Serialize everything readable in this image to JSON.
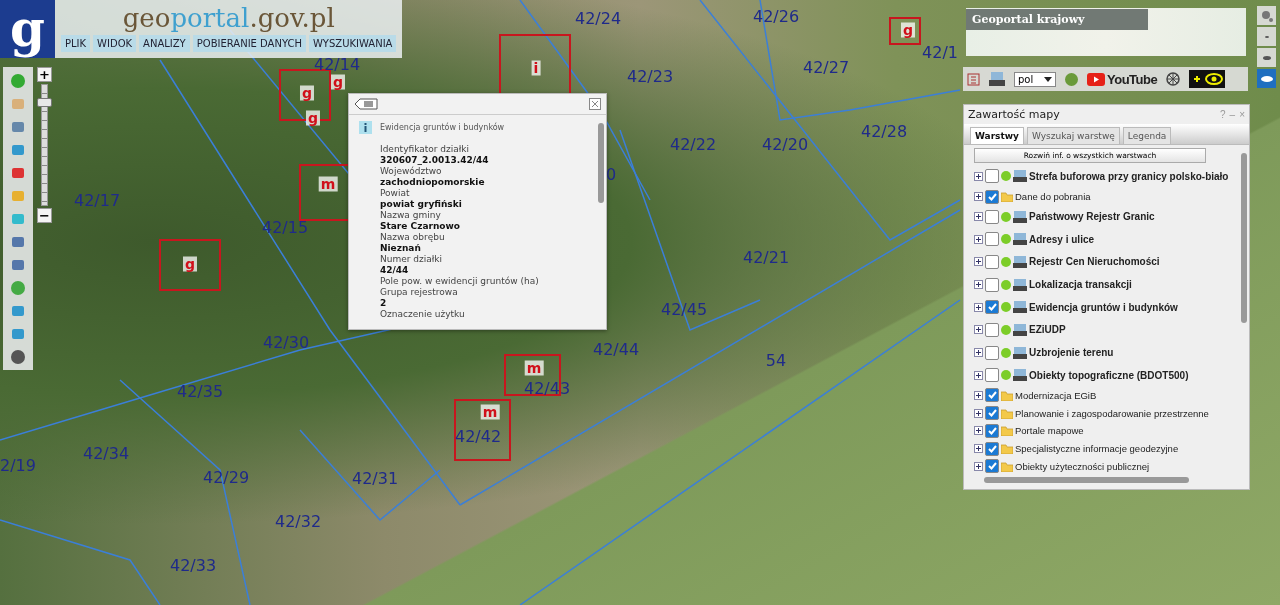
{
  "header": {
    "logo": "g",
    "site_title": [
      {
        "text": "geo",
        "color": "#6a5638"
      },
      {
        "text": "portal",
        "color": "#3fa0cf"
      },
      {
        "text": ".gov.pl",
        "color": "#6a5638"
      }
    ],
    "menu": [
      "PLIK",
      "WIDOK",
      "ANALIZY",
      "POBIERANIE DANYCH",
      "WYSZUKIWANIA"
    ]
  },
  "zoom": {
    "zoom_in": "+",
    "zoom_out": "−",
    "level": 0.88
  },
  "map": {
    "parcels": [
      "42/24",
      "42/26",
      "42/1",
      "42/14",
      "42/23",
      "42/27",
      "42/28",
      "42/22",
      "42/20",
      "42/17",
      "42/15",
      "0",
      "42/21",
      "42/45",
      "42/30",
      "42/44",
      "54",
      "42/43",
      "42/35",
      "42/42",
      "2/19",
      "42/34",
      "42/29",
      "42/31",
      "42/32",
      "42/33"
    ],
    "buildings": [
      "g",
      "g",
      "g",
      "g",
      "i",
      "m",
      "g",
      "m",
      "m"
    ]
  },
  "popup": {
    "layer": "Ewidencja gruntów i budynków",
    "fields": [
      {
        "label": "Identyfikator działki",
        "value": "320607_2.0013.42/44"
      },
      {
        "label": "Województwo",
        "value": "zachodniopomorskie"
      },
      {
        "label": "Powiat",
        "value": "powiat gryfiński"
      },
      {
        "label": "Nazwa gminy",
        "value": "Stare Czarnowo"
      },
      {
        "label": "Nazwa obrębu",
        "value": "Nieznań"
      },
      {
        "label": "Numer działki",
        "value": "42/44"
      },
      {
        "label": "Pole pow. w ewidencji gruntów (ha)"
      },
      {
        "label": "Grupa rejestrowa",
        "value": "2"
      },
      {
        "label": "Oznaczenie użytku"
      }
    ]
  },
  "minimap": {
    "title": "Geoportal krajowy"
  },
  "toolbar": {
    "language": "pol",
    "video": "YouTube"
  },
  "view_modes": [
    {
      "selected": false
    },
    {
      "selected": false
    },
    {
      "selected": true
    }
  ],
  "layers_panel": {
    "title": "Zawartość mapy",
    "controls": [
      "?",
      "–",
      "×"
    ],
    "tabs": [
      {
        "label": "Warstwy",
        "selected": true
      },
      {
        "label": "Wyszukaj warstwę",
        "selected": false
      },
      {
        "label": "Legenda",
        "selected": false
      }
    ],
    "expand_all": "Rozwiń inf. o wszystkich warstwach",
    "layers": [
      {
        "name": "Strefa buforowa przy granicy polsko-biało",
        "kind": "service",
        "checked": false
      },
      {
        "name": "Dane do pobrania",
        "kind": "folder",
        "checked": true
      },
      {
        "name": "Państwowy Rejestr Granic",
        "kind": "service",
        "checked": false
      },
      {
        "name": "Adresy i ulice",
        "kind": "service",
        "checked": false
      },
      {
        "name": "Rejestr Cen Nieruchomości",
        "kind": "service",
        "checked": false
      },
      {
        "name": "Lokalizacja transakcji",
        "kind": "service",
        "checked": false
      },
      {
        "name": "Ewidencja gruntów i budynków",
        "kind": "service",
        "checked": true
      },
      {
        "name": "EZiUDP",
        "kind": "service",
        "checked": false
      },
      {
        "name": "Uzbrojenie terenu",
        "kind": "service",
        "checked": false
      },
      {
        "name": "Obiekty topograficzne (BDOT500)",
        "kind": "service",
        "checked": false
      },
      {
        "name": "Modernizacja EGiB",
        "kind": "folder",
        "checked": true
      },
      {
        "name": "Planowanie i zagospodarowanie przestrzenne",
        "kind": "folder",
        "checked": true
      },
      {
        "name": "Portale mapowe",
        "kind": "folder",
        "checked": true
      },
      {
        "name": "Specjalistyczne informacje geodezyjne",
        "kind": "folder",
        "checked": true
      },
      {
        "name": "Obiekty użyteczności publicznej",
        "kind": "folder",
        "checked": true
      }
    ]
  }
}
